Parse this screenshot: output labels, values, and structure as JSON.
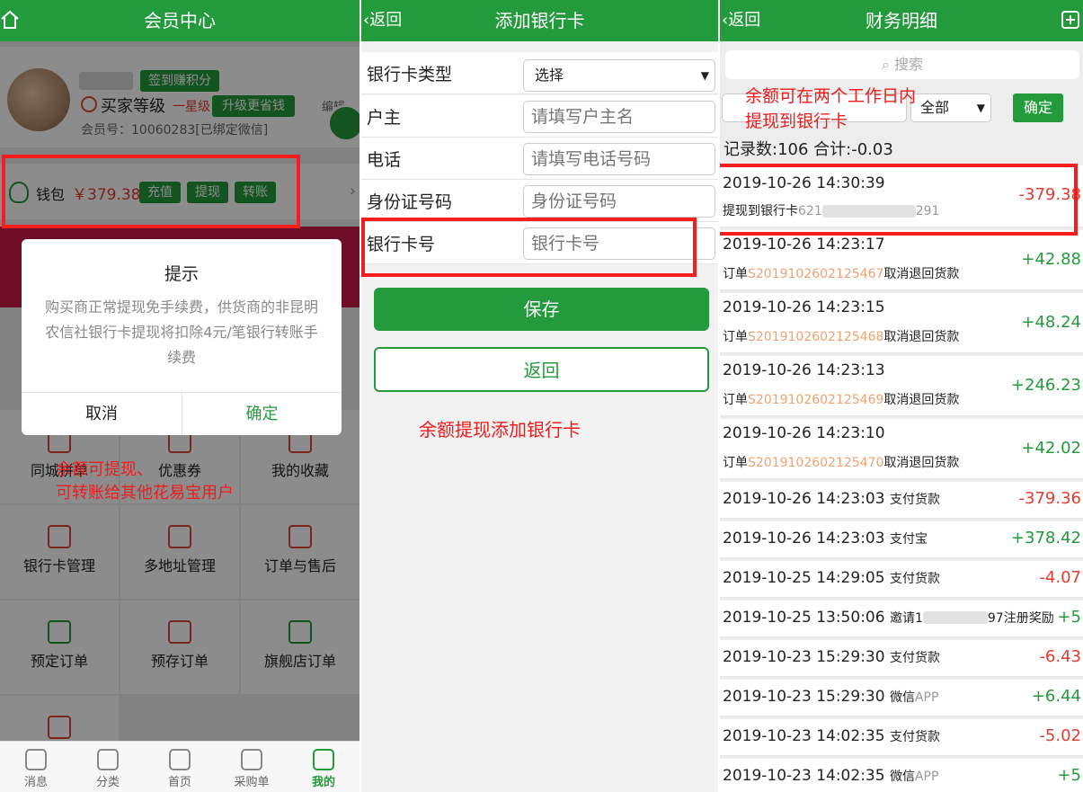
{
  "member": {
    "title": "会员中心",
    "checkin_label": "签到赚积分",
    "level_label": "买家等级",
    "level_star": "一星级",
    "upgrade_label": "升级更省钱",
    "member_no": "会员号：10060283[已绑定微信]",
    "edit_label": "编辑",
    "wallet_label": "钱包",
    "wallet_amount": "￥379.38",
    "recharge_label": "充值",
    "withdraw_label": "提现",
    "transfer_label": "转账",
    "dialog": {
      "title": "提示",
      "message": "购买商正常提现免手续费，供货商的非昆明农信社银行卡提现将扣除4元/笔银行转账手续费",
      "cancel": "取消",
      "ok": "确定"
    },
    "grid": [
      "同城拼单",
      "优惠券",
      "我的收藏",
      "银行卡管理",
      "多地址管理",
      "订单与售后",
      "预定订单",
      "预存订单",
      "旗舰店订单"
    ],
    "annotation_line1": "余额可提现、",
    "annotation_line2": "可转账给其他花易宝用户",
    "tabs": [
      "消息",
      "分类",
      "首页",
      "采购单",
      "我的"
    ]
  },
  "addcard": {
    "back_label": "返回",
    "title": "添加银行卡",
    "rows": [
      {
        "label": "银行卡类型",
        "select": "选择"
      },
      {
        "label": "户主",
        "placeholder": "请填写户主名"
      },
      {
        "label": "电话",
        "placeholder": "请填写电话号码"
      },
      {
        "label": "身份证号码",
        "placeholder": "身份证号码"
      },
      {
        "label": "银行卡号",
        "placeholder": "银行卡号"
      }
    ],
    "save_label": "保存",
    "return_label": "返回",
    "annotation": "余额提现添加银行卡"
  },
  "finance": {
    "back_label": "返回",
    "title": "财务明细",
    "search_placeholder": "搜索",
    "filter_all": "全部",
    "confirm_label": "确定",
    "summary": "记录数:106 合计:-0.03",
    "annotation_line1": "余额可在两个工作日内",
    "annotation_line2": "提现到银行卡",
    "records": [
      {
        "date": "2019-10-26 14:30:39",
        "desc_prefix": "提现到银行卡",
        "desc_mid": "621",
        "desc_suffix": "291",
        "amount": "-379.38",
        "sign": "neg"
      },
      {
        "date": "2019-10-26 14:23:17",
        "desc_prefix": "订单",
        "order": "S2019102602125467",
        "desc_suffix": "取消退回货款",
        "amount": "+42.88",
        "sign": "pos"
      },
      {
        "date": "2019-10-26 14:23:15",
        "desc_prefix": "订单",
        "order": "S2019102602125468",
        "desc_suffix": "取消退回货款",
        "amount": "+48.24",
        "sign": "pos"
      },
      {
        "date": "2019-10-26 14:23:13",
        "desc_prefix": "订单",
        "order": "S2019102602125469",
        "desc_suffix": "取消退回货款",
        "amount": "+246.23",
        "sign": "pos"
      },
      {
        "date": "2019-10-26 14:23:10",
        "desc_prefix": "订单",
        "order": "S2019102602125470",
        "desc_suffix": "取消退回货款",
        "amount": "+42.02",
        "sign": "pos"
      },
      {
        "date": "2019-10-26 14:23:03",
        "desc": "支付货款",
        "amount": "-379.36",
        "sign": "neg"
      },
      {
        "date": "2019-10-26 14:23:03",
        "desc": "支付宝",
        "amount": "+378.42",
        "sign": "pos"
      },
      {
        "date": "2019-10-25 14:29:05",
        "desc": "支付货款",
        "amount": "-4.07",
        "sign": "neg"
      },
      {
        "date": "2019-10-25 13:50:06",
        "desc": "邀请1",
        "desc_suffix": "97注册奖励",
        "amount": "+5",
        "sign": "pos"
      },
      {
        "date": "2019-10-23 15:29:30",
        "desc": "支付货款",
        "amount": "-6.43",
        "sign": "neg"
      },
      {
        "date": "2019-10-23 15:29:30",
        "desc": "微信",
        "desc_gray": "APP",
        "amount": "+6.44",
        "sign": "pos"
      },
      {
        "date": "2019-10-23 14:02:35",
        "desc": "支付货款",
        "amount": "-5.02",
        "sign": "neg"
      },
      {
        "date": "2019-10-23 14:02:35",
        "desc": "微信",
        "desc_gray": "APP",
        "amount": "+5",
        "sign": "pos"
      }
    ]
  }
}
